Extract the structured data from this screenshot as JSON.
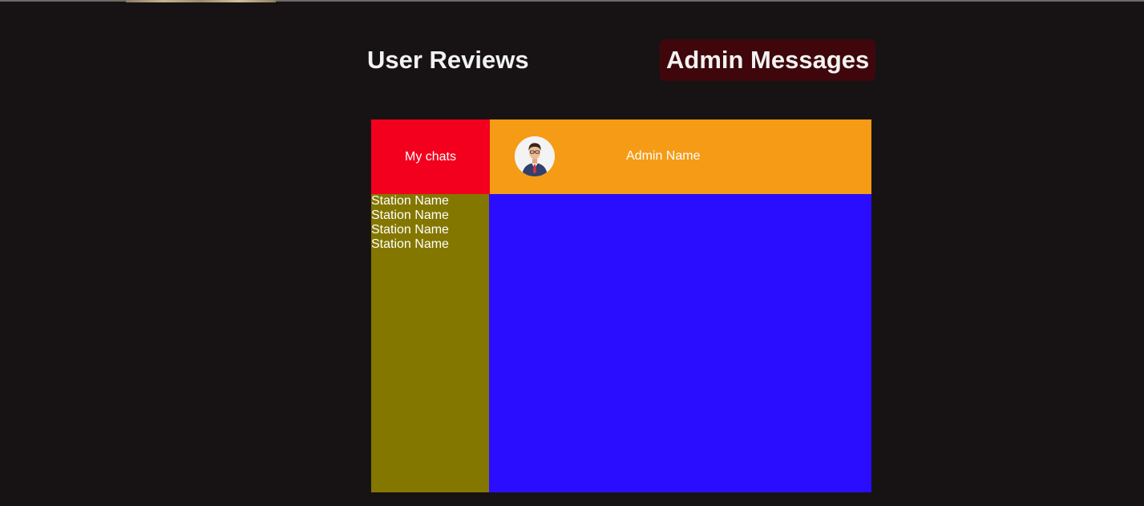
{
  "tabs": {
    "user_reviews": "User Reviews",
    "admin_messages": "Admin Messages"
  },
  "chat": {
    "my_chats_label": "My chats",
    "admin_name": "Admin Name",
    "avatar_icon": "admin-avatar-icon",
    "stations": [
      {
        "label": "Station Name"
      },
      {
        "label": "Station Name"
      },
      {
        "label": "Station Name"
      },
      {
        "label": "Station Name"
      }
    ]
  },
  "colors": {
    "background": "#171314",
    "active_tab_bg": "#3f070b",
    "my_chats_bg": "#f2001d",
    "conversation_header_bg": "#f59b15",
    "station_list_bg": "#847700",
    "messages_area_bg": "#2a0dff"
  }
}
